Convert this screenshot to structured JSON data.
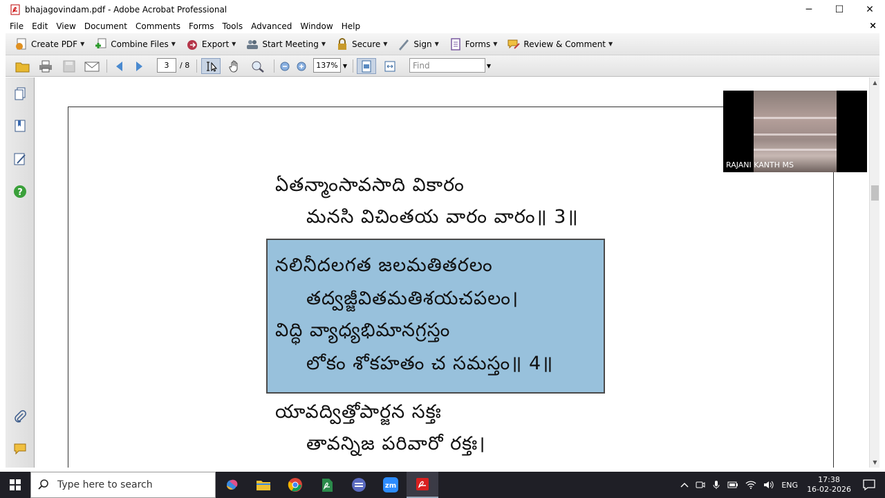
{
  "window": {
    "title": "bhajagovindam.pdf - Adobe Acrobat Professional",
    "minimize": "─",
    "maximize": "☐",
    "close": "✕"
  },
  "menu": {
    "items": [
      "File",
      "Edit",
      "View",
      "Document",
      "Comments",
      "Forms",
      "Tools",
      "Advanced",
      "Window",
      "Help"
    ],
    "close_doc": "×"
  },
  "toolbar": {
    "create_pdf": "Create PDF",
    "combine_files": "Combine Files",
    "export": "Export",
    "start_meeting": "Start Meeting",
    "secure": "Secure",
    "sign": "Sign",
    "forms": "Forms",
    "review_comment": "Review & Comment"
  },
  "nav": {
    "current_page": "3",
    "total_pages": "/ 8",
    "zoom": "137%",
    "find_placeholder": "Find"
  },
  "document": {
    "verses": [
      "ఏతన్మాంసావసాది వికారం",
      "మనసి విచింతయ వారం వారం॥ 3॥",
      "నలినీదలగత జలమతితరలం",
      "తద్వజ్జీవితమతిశయచపలం।",
      "విద్ధి వ్యాధ్యభిమానగ్రస్తం",
      "లోకం శోకహతం చ సమస్తం॥ 4॥",
      "యావద్విత్తోపార్జన సక్తః",
      "తావన్నిజ పరివారో రక్తః।"
    ]
  },
  "webcam": {
    "participant": "RAJANI KANTH MS"
  },
  "taskbar": {
    "search_placeholder": "Type here to search",
    "language": "ENG",
    "time": "17:38",
    "date": "16-02-2026"
  },
  "colors": {
    "highlight": "#98c1dc",
    "taskbar": "#1f1f26"
  }
}
